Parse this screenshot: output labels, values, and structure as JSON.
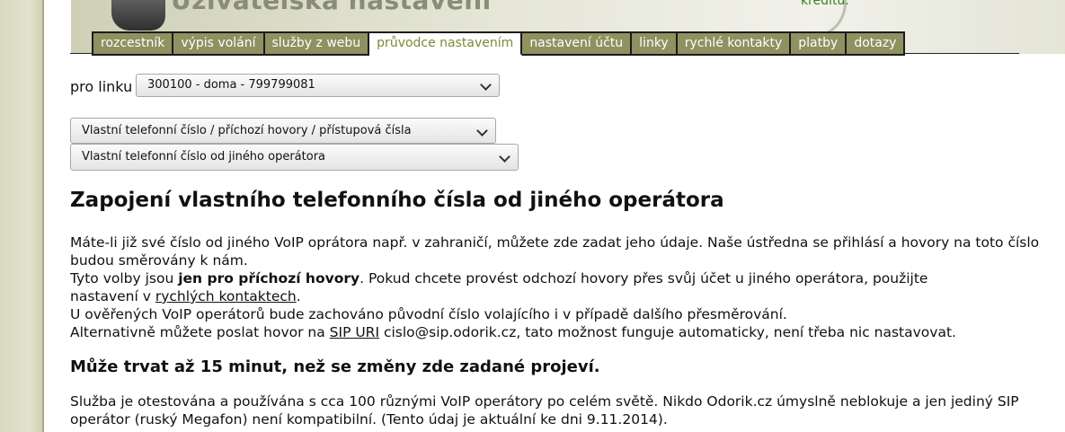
{
  "header": {
    "title": "Uživatelská nastavení",
    "credit_link": "kreditu."
  },
  "tabs": [
    {
      "label": "rozcestník",
      "active": false
    },
    {
      "label": "výpis volání",
      "active": false
    },
    {
      "label": "služby z webu",
      "active": false
    },
    {
      "label": "průvodce nastavením",
      "active": true
    },
    {
      "label": "nastavení účtu",
      "active": false
    },
    {
      "label": "linky",
      "active": false
    },
    {
      "label": "rychlé kontakty",
      "active": false
    },
    {
      "label": "platby",
      "active": false
    },
    {
      "label": "dotazy",
      "active": false
    }
  ],
  "line_select": {
    "label": "pro linku",
    "value": "300100 - doma - 799799081"
  },
  "category_select": {
    "value": "Vlastní telefonní číslo / příchozí hovory / přístupová čísla"
  },
  "subcategory_select": {
    "value": "Vlastní telefonní číslo od jiného operátora"
  },
  "main": {
    "heading": "Zapojení vlastního telefonního čísla od jiného operátora",
    "p1": "Máte-li již své číslo od jiného VoIP oprátora např. v zahraničí, můžete zde zadat jeho údaje. Naše ústředna se přihlásí a hovory na toto číslo budou směrovány k nám.",
    "p2_before": "Tyto volby jsou ",
    "p2_bold": "jen pro příchozí hovory",
    "p2_after": ". Pokud chcete provést odchozí hovory přes svůj účet u jiného operátora, použijte",
    "p3_before": "nastavení v ",
    "p3_link": "rychlých kontaktech",
    "p3_after": ".",
    "p4": "U ověřených VoIP operátorů bude zachováno původní číslo volajícího i v případě dalšího přesměrování.",
    "p5_before": "Alternativně můžete poslat hovor na ",
    "p5_link": "SIP URI",
    "p5_after": " cislo@sip.odorik.cz, tato možnost funguje automaticky, není třeba nic nastavovat.",
    "subheading": "Může trvat až 15 minut, než se změny zde zadané projeví.",
    "p6": "Služba je otestována a používána s cca 100 různými VoIP operátory po celém světě. Nikdo Odorik.cz úmyslně neblokuje a jen jediný SIP operátor (ruský Megafon) není kompatibilní. (Tento údaj je aktuální ke dni 9.11.2014)."
  }
}
